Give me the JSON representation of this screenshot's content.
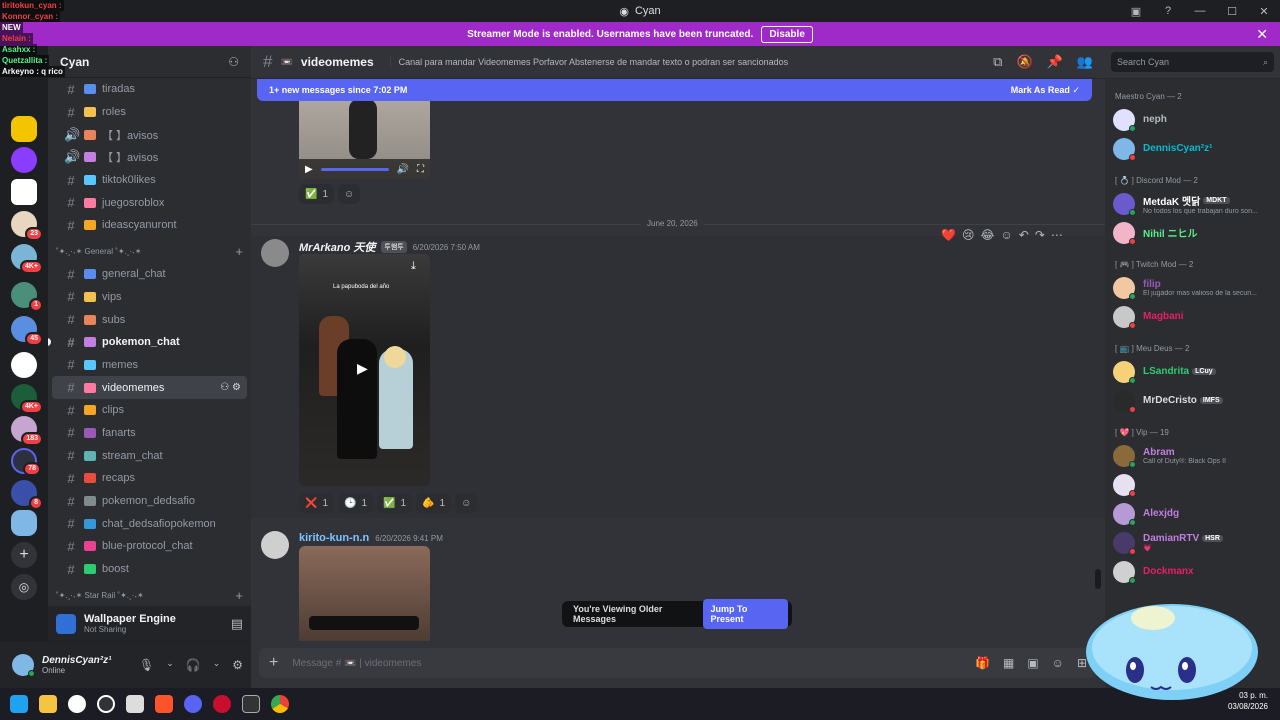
{
  "window": {
    "title": "Cyan"
  },
  "streamer": {
    "text": "Streamer Mode is enabled. Usernames have been truncated.",
    "disable_label": "Disable"
  },
  "overlay_chat": [
    {
      "user": "tiritokun_cyan :",
      "color": "#f23f43"
    },
    {
      "user": "Konnor_cyan :",
      "color": "#f23f43"
    },
    {
      "user": "NEW",
      "color": "#ffffff"
    },
    {
      "user": "Nelain :",
      "color": "#f23f43"
    },
    {
      "user": "Asahxx :",
      "color": "#57f287"
    },
    {
      "user": "Quetzallita :",
      "color": "#57f287"
    },
    {
      "user": "Arkeyno : q rico",
      "color": "#ffffff"
    }
  ],
  "server": {
    "name": "Cyan"
  },
  "channels_top": [
    {
      "name": "tiradas",
      "type": "text"
    },
    {
      "name": "roles",
      "type": "text"
    },
    {
      "name": "【 】avisos",
      "type": "voice"
    },
    {
      "name": "【 】avisos",
      "type": "voice"
    },
    {
      "name": "tiktok0likes",
      "type": "text"
    },
    {
      "name": "juegosroblox",
      "type": "text"
    },
    {
      "name": "ideascyanuront",
      "type": "text"
    }
  ],
  "category_general": "˚✦.˳·˖✶ General ˚✦.˳·˖✶",
  "channels_general": [
    {
      "name": "general_chat",
      "unread": false
    },
    {
      "name": "vips",
      "unread": false
    },
    {
      "name": "subs",
      "unread": false
    },
    {
      "name": "pokemon_chat",
      "unread": true
    },
    {
      "name": "memes",
      "unread": false
    },
    {
      "name": "videomemes",
      "active": true
    },
    {
      "name": "clips",
      "unread": false
    },
    {
      "name": "fanarts",
      "unread": false
    },
    {
      "name": "stream_chat",
      "unread": false
    },
    {
      "name": "recaps",
      "unread": false
    },
    {
      "name": "pokemon_dedsafio",
      "unread": false
    },
    {
      "name": "chat_dedsafiopokemon",
      "unread": false
    },
    {
      "name": "blue-protocol_chat",
      "unread": false
    },
    {
      "name": "boost",
      "unread": false
    }
  ],
  "category_starrail": "˚✦.˳·˖✶ Star Rail ˚✦.˳·˖✶",
  "activity": {
    "title": "Wallpaper Engine",
    "sub": "Not Sharing"
  },
  "user": {
    "name": "DennisCyan²z¹",
    "status": "Online"
  },
  "header": {
    "channel": "videomemes",
    "topic": "Canal para mandar Videomemes Porfavor Abstenerse de mandar texto o podran ser sancionados",
    "search_placeholder": "Search Cyan"
  },
  "new_messages": {
    "text": "1+ new messages since 7:02 PM",
    "mark": "Mark As Read"
  },
  "date_divider": "June 20, 2026",
  "messages": [
    {
      "author": "MrArkano 天使",
      "tag": "투햄투",
      "time": "6/20/2026 7:50 AM",
      "video_caption": "La papuboda del año"
    },
    {
      "author": "kirito-kun-n.n",
      "time": "6/20/2026 9:41 PM"
    }
  ],
  "reactions_top": [
    {
      "emoji": "✅",
      "count": "1"
    }
  ],
  "reactions_msg1": [
    {
      "emoji": "❌",
      "count": "1"
    },
    {
      "emoji": "🕒",
      "count": "1"
    },
    {
      "emoji": "✅",
      "count": "1"
    },
    {
      "emoji": "🫵",
      "count": "1"
    }
  ],
  "older": {
    "text": "You're Viewing Older Messages",
    "jump": "Jump To Present"
  },
  "composer": {
    "placeholder": "Message # 📼 | videomemes"
  },
  "members": {
    "groups": [
      {
        "title": "Maestro Cyan — 2",
        "items": [
          {
            "name": "neph",
            "color": "#b5bac1",
            "status": ""
          },
          {
            "name": "DennisCyan²z¹",
            "color": "#00bcd4",
            "status": ""
          }
        ]
      },
      {
        "title": "[ 💍 ] Discord Mod — 2",
        "items": [
          {
            "name": "MetdaK 멧닭",
            "color": "#ffffff",
            "tag": "MDKT",
            "status": "No todos los que trabajan duro son..."
          },
          {
            "name": "Nihil ニヒル",
            "color": "#57f287",
            "status": ""
          }
        ]
      },
      {
        "title": "[ 🎮 ] Twitch Mod — 2",
        "items": [
          {
            "name": "filip",
            "color": "#9b59b6",
            "status": "El jugador mas valioso de la secun..."
          },
          {
            "name": "Magbani",
            "color": "#e91e63",
            "status": ""
          }
        ]
      },
      {
        "title": "[ 📺 ] Meu Deus — 2",
        "items": [
          {
            "name": "LSandrita",
            "color": "#2ecc71",
            "tag": "LCuy",
            "status": ""
          },
          {
            "name": "MrDeCristo",
            "color": "#dbdee1",
            "tag": "IMFS",
            "status": ""
          }
        ]
      },
      {
        "title": "[ 💖 ] Vip — 19",
        "items": [
          {
            "name": "Abram",
            "color": "#c27ee0",
            "status": "Call of Duty®: Black Ops II"
          },
          {
            "name": "",
            "color": "#c27ee0",
            "status": ""
          },
          {
            "name": "Alexjdg",
            "color": "#c27ee0",
            "status": ""
          },
          {
            "name": "DamianRTV",
            "color": "#c27ee0",
            "tag": "HSR",
            "status": "💗"
          },
          {
            "name": "Dockmanx",
            "color": "#e91e63",
            "status": ""
          }
        ]
      }
    ]
  },
  "clock": {
    "time": "03 p. m.",
    "date": "03/08/2026"
  },
  "colors": {
    "accent": "#5865f2",
    "streamer_bar": "#a02ac8",
    "online": "#23a55a",
    "dnd": "#f23f43"
  }
}
